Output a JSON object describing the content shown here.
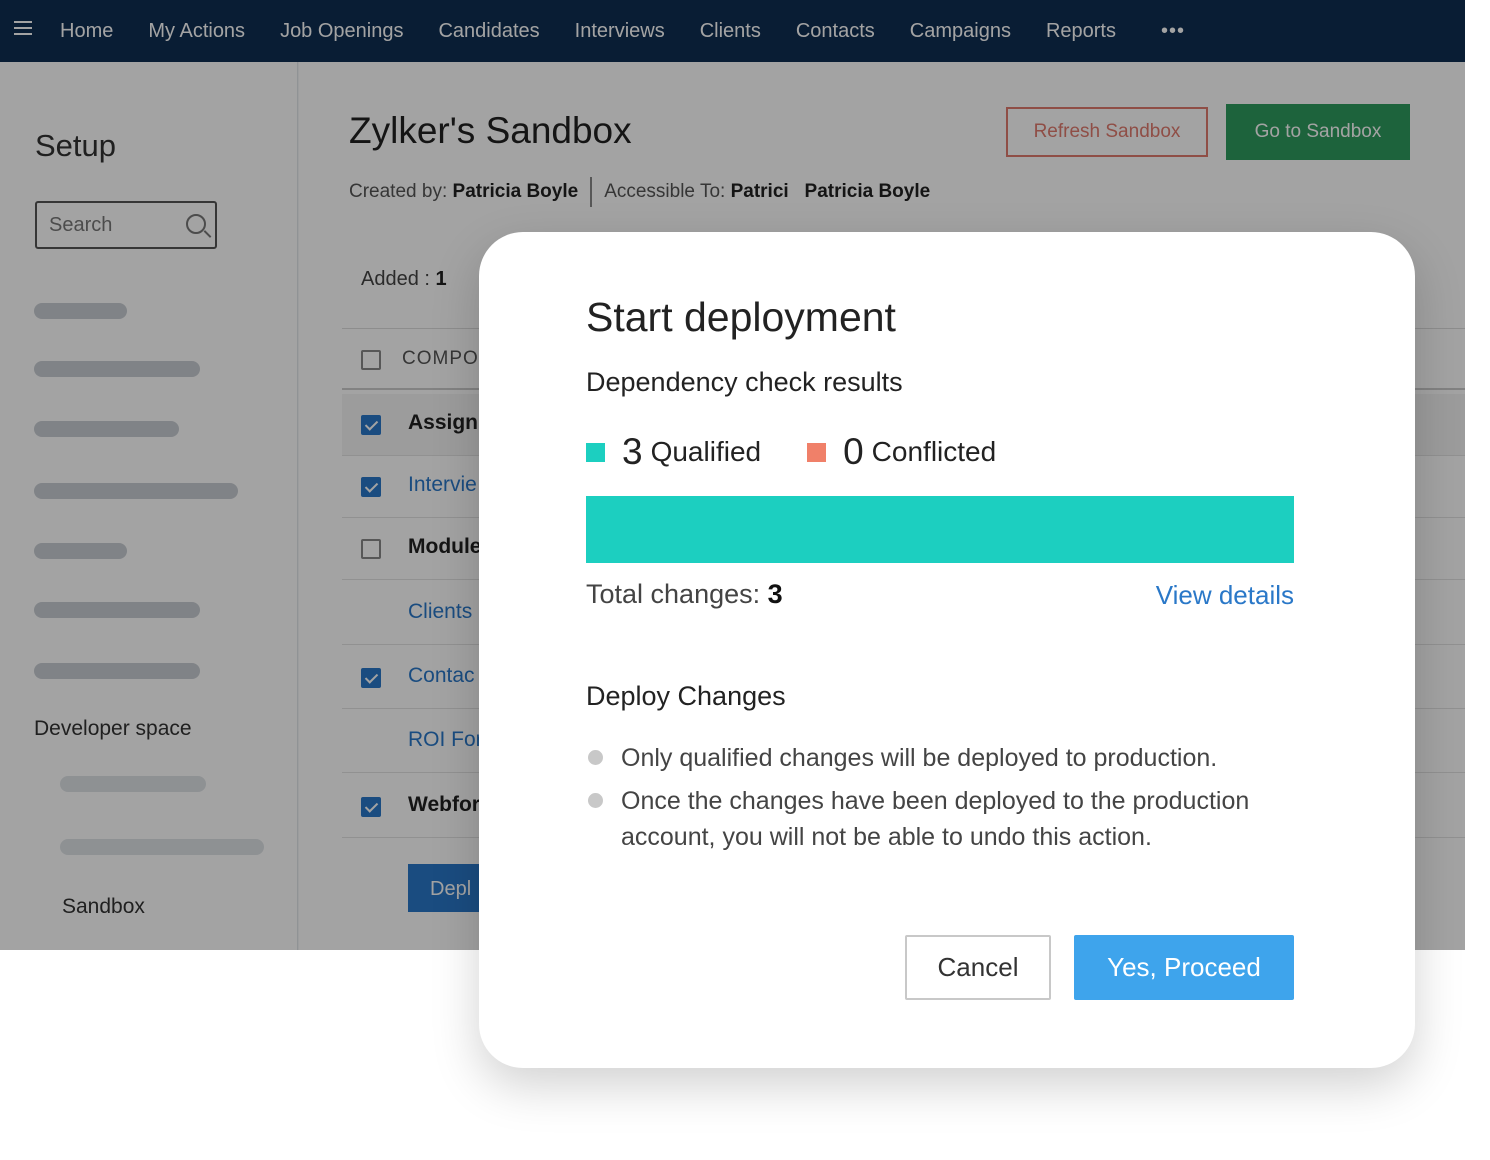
{
  "topnav": {
    "items": [
      "Home",
      "My Actions",
      "Job Openings",
      "Candidates",
      "Interviews",
      "Clients",
      "Contacts",
      "Campaigns",
      "Reports"
    ],
    "more": "•••"
  },
  "sidebar": {
    "title": "Setup",
    "search_placeholder": "Search",
    "section": "Developer space",
    "sandbox_item": "Sandbox"
  },
  "main": {
    "title": "Zylker's Sandbox",
    "created_by_label": "Created by:",
    "created_by": "Patricia Boyle",
    "accessible_label": "Accessible To:",
    "accessible_truncated": "Patrici",
    "accessible_to": "Patricia Boyle",
    "refresh_button": "Refresh Sandbox",
    "go_button": "Go to Sandbox",
    "added_label": "Added :",
    "added_count": "1",
    "table_header": "COMPO",
    "rows": [
      {
        "label": "Assignm",
        "style": "dark",
        "checkbox": "checked",
        "gray": true
      },
      {
        "label": "Intervie",
        "style": "link",
        "checkbox": "checked",
        "gray": false
      },
      {
        "label": "Module",
        "style": "dark",
        "checkbox": "unchecked",
        "gray": false
      },
      {
        "label": "Clients",
        "style": "link",
        "checkbox": "none",
        "gray": false
      },
      {
        "label": "Contac",
        "style": "link",
        "checkbox": "checked",
        "gray": false
      },
      {
        "label": "ROI For",
        "style": "link",
        "checkbox": "none",
        "gray": false
      },
      {
        "label": "Webfor",
        "style": "dark",
        "checkbox": "checked",
        "gray": false
      }
    ],
    "deploy_button": "Depl"
  },
  "modal": {
    "title": "Start deployment",
    "subtitle": "Dependency check results",
    "qualified_count": "3",
    "qualified_label": "Qualified",
    "conflicted_count": "0",
    "conflicted_label": "Conflicted",
    "qualified_fraction": 1.0,
    "total_label": "Total changes:",
    "total_value": "3",
    "view_details": "View details",
    "deploy_heading": "Deploy Changes",
    "bullets": [
      "Only qualified changes will be deployed to production.",
      "Once the changes have been deployed to the production account, you will not be able to undo this action."
    ],
    "cancel_button": "Cancel",
    "proceed_button": "Yes, Proceed"
  },
  "colors": {
    "nav_bg": "#0f2e52",
    "qualified": "#1ccfc0",
    "conflicted": "#f08069",
    "primary": "#3ea4ec",
    "link": "#2a78c8",
    "go_green": "#2e9b5e",
    "refresh_red": "#e07a6e"
  }
}
